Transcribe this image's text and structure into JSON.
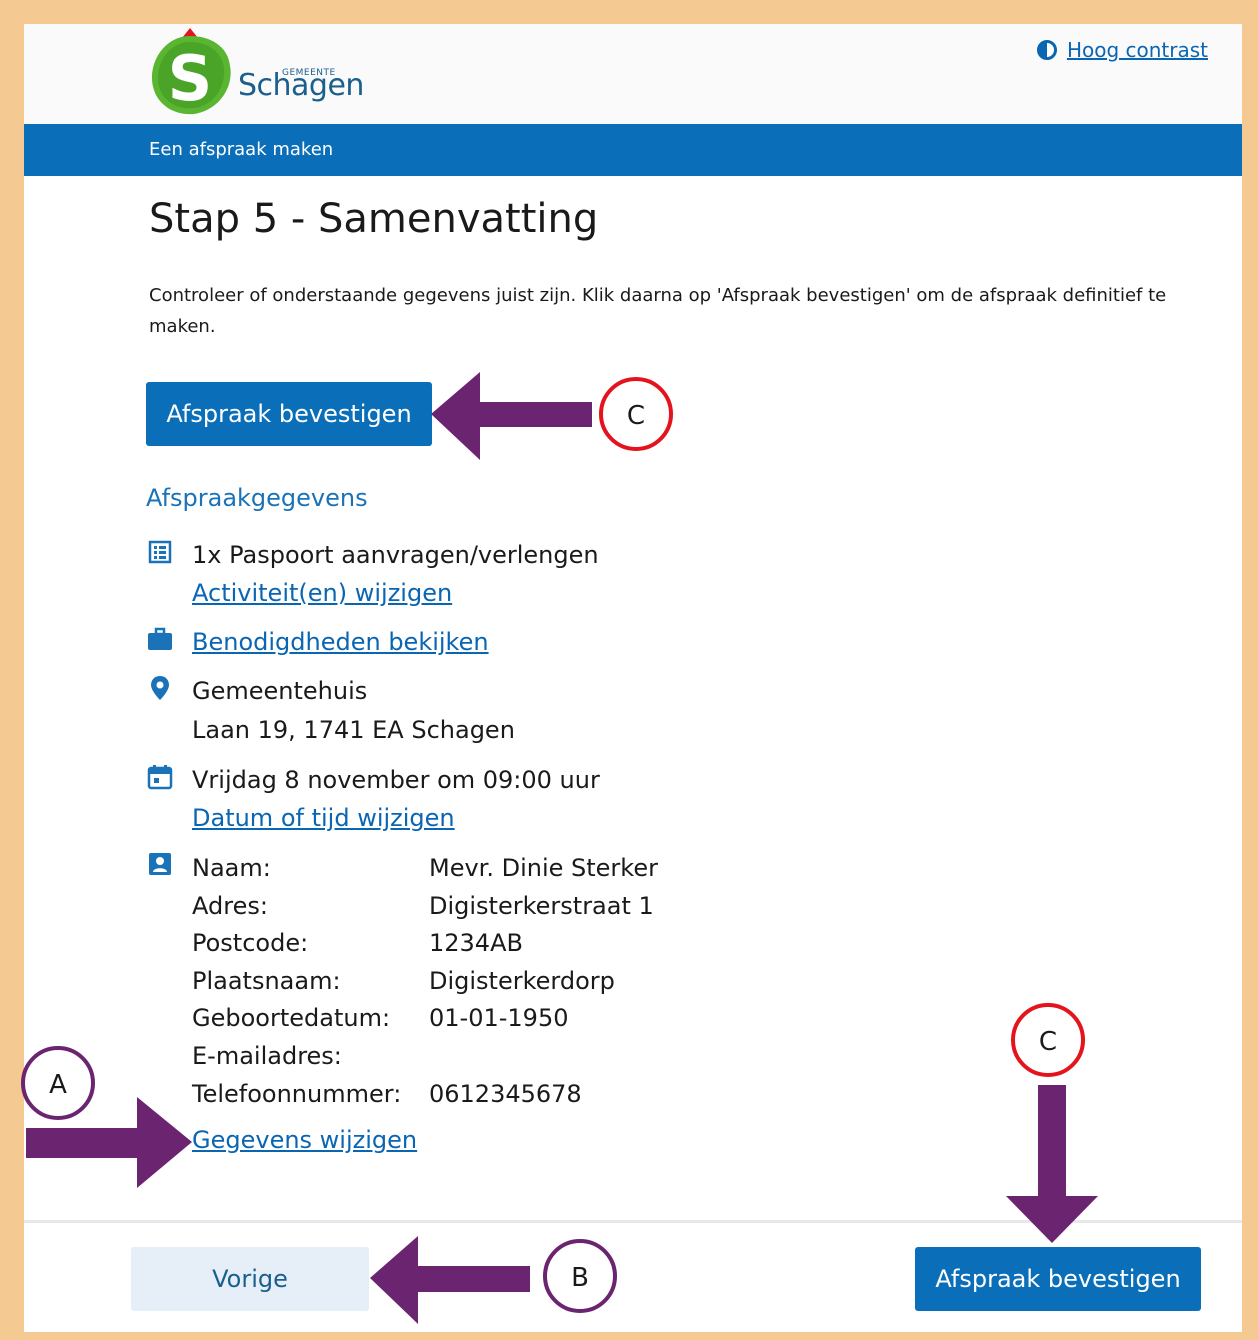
{
  "header": {
    "logo_small": "GEMEENTE",
    "logo_word": "Schagen",
    "contrast_link": "Hoog contrast"
  },
  "breadcrumb": "Een afspraak maken",
  "page_title": "Stap 5 - Samenvatting",
  "intro": "Controleer of onderstaande gegevens juist zijn. Klik daarna op 'Afspraak bevestigen' om de afspraak definitief te maken.",
  "confirm_label": "Afspraak bevestigen",
  "section_title": "Afspraakgegevens",
  "activity": {
    "text": "1x Paspoort aanvragen/verlengen",
    "change_link": "Activiteit(en) wijzigen"
  },
  "requirements_link": "Benodigdheden bekijken",
  "location": {
    "name": "Gemeentehuis",
    "address": "Laan 19, 1741 EA Schagen"
  },
  "datetime": {
    "text": "Vrijdag 8 november om 09:00 uur",
    "change_link": "Datum of tijd wijzigen"
  },
  "personal": {
    "rows": [
      {
        "label": "Naam:",
        "value": "Mevr. Dinie Sterker"
      },
      {
        "label": "Adres:",
        "value": "Digisterkerstraat 1"
      },
      {
        "label": "Postcode:",
        "value": "1234AB"
      },
      {
        "label": "Plaatsnaam:",
        "value": "Digisterkerdorp"
      },
      {
        "label": "Geboortedatum:",
        "value": "01-01-1950"
      },
      {
        "label": "E-mailadres:",
        "value": ""
      },
      {
        "label": "Telefoonnummer:",
        "value": "0612345678"
      }
    ],
    "change_link": "Gegevens wijzigen"
  },
  "footer": {
    "prev_label": "Vorige",
    "confirm_label": "Afspraak bevestigen"
  },
  "annotations": {
    "a": "A",
    "b": "B",
    "c": "C"
  },
  "colors": {
    "brand_blue": "#0a6fb8",
    "arrow_purple": "#6b2470",
    "circle_red": "#e3141d",
    "frame_orange": "#f5c992"
  }
}
